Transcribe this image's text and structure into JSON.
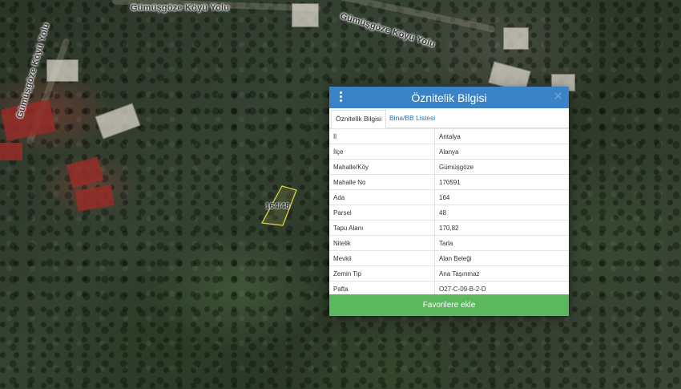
{
  "map": {
    "road_labels": [
      "Gümüşgöze Köyü Yolu",
      "Gümüşgöze Köyü Yolu",
      "Gümüşgöze Köyü Yolu"
    ],
    "parcel_label": "164/48",
    "parcel_color": "#d9d24a"
  },
  "panel": {
    "title": "Öznitelik Bilgisi",
    "close_symbol": "✕",
    "header_color": "#3a83c7",
    "tabs": [
      {
        "label": "Öznitelik Bilgisi",
        "active": true
      },
      {
        "label": "Bina/BB Listesi",
        "active": false
      }
    ],
    "rows": [
      {
        "key": "İl",
        "value": "Antalya"
      },
      {
        "key": "İlçe",
        "value": "Alanya"
      },
      {
        "key": "Mahalle/Köy",
        "value": "Gümüşgöze"
      },
      {
        "key": "Mahalle No",
        "value": "170591"
      },
      {
        "key": "Ada",
        "value": "164"
      },
      {
        "key": "Parsel",
        "value": "48"
      },
      {
        "key": "Tapu Alanı",
        "value": "170,82"
      },
      {
        "key": "Nitelik",
        "value": "Tarla"
      },
      {
        "key": "Mevkii",
        "value": "Alan Beleği"
      },
      {
        "key": "Zemin Tip",
        "value": "Ana Taşınmaz"
      },
      {
        "key": "Pafta",
        "value": "O27-C-09-B-2-D"
      }
    ],
    "favorite_button": "Favorilere ekle",
    "favorite_color": "#5cb85c"
  }
}
